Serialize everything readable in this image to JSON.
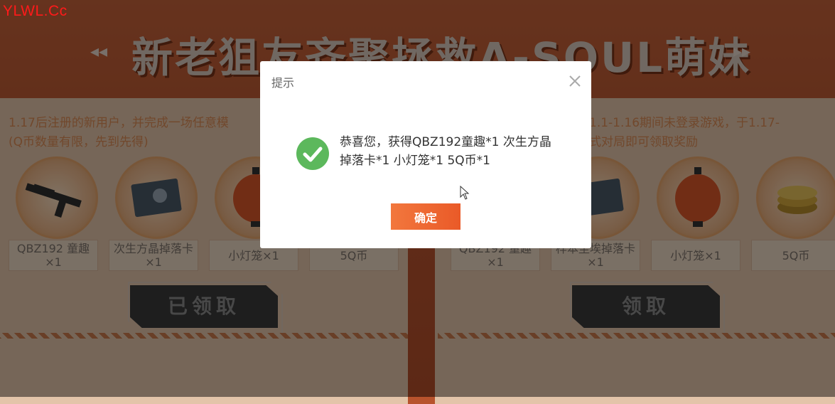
{
  "watermark": "YLWL.Cc",
  "banner": {
    "title": "新老狙友齐聚拯救A-SOUL萌妹",
    "arrow_left": "◂◂",
    "arrow_right": "▸▸"
  },
  "left_panel": {
    "desc_line1": "1.17后注册的新用户，并完成一场任意模",
    "desc_line2": "(Q币数量有限，先到先得)",
    "rewards": [
      {
        "label": "QBZ192 童趣\n×1",
        "icon": "rifle-icon"
      },
      {
        "label": "次生方晶掉落卡\n×1",
        "icon": "drop-card-icon"
      },
      {
        "label": "小灯笼×1",
        "icon": "lantern-icon"
      },
      {
        "label": "5Q币",
        "icon": "coin-icon"
      }
    ],
    "claim_label": "已领取"
  },
  "right_panel": {
    "desc_line1": "在1.1-1.16期间未登录游戏，于1.17-",
    "desc_line2": "模式对局即可领取奖励",
    "rewards": [
      {
        "label": "QBZ192 童趣\n×1",
        "icon": "rifle-icon"
      },
      {
        "label": "样本尘埃掉落卡\n×1",
        "icon": "drop-card-icon"
      },
      {
        "label": "小灯笼×1",
        "icon": "lantern-icon"
      },
      {
        "label": "5Q币",
        "icon": "coin-icon"
      }
    ],
    "claim_label": "领取"
  },
  "modal": {
    "title": "提示",
    "message": "恭喜您，获得QBZ192童趣*1 次生方晶掉落卡*1 小灯笼*1 5Q币*1",
    "ok_label": "确定",
    "close_icon": "close-icon",
    "status_icon": "success-check-icon"
  },
  "colors": {
    "accent": "#ea5a28",
    "success": "#5cb85c",
    "watermark": "#ff1a1a"
  }
}
